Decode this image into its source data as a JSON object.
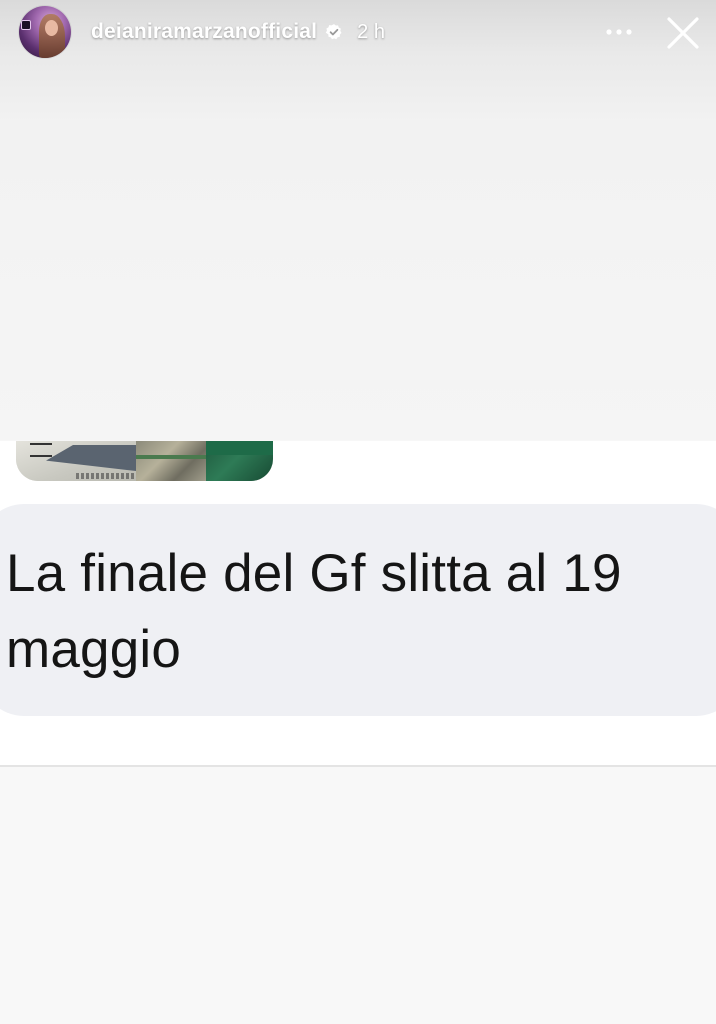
{
  "header": {
    "username": "deianiramarzanofficial",
    "time": "2 h",
    "more_icon": "more-horizontal-icon",
    "close_icon": "close-icon",
    "verified_icon": "verified-badge-icon",
    "verified_color": "#ffffff"
  },
  "story": {
    "message_text": "La finale del Gf slitta al 19 maggio",
    "bubble_color": "#eff0f4",
    "text_color": "#151515"
  }
}
